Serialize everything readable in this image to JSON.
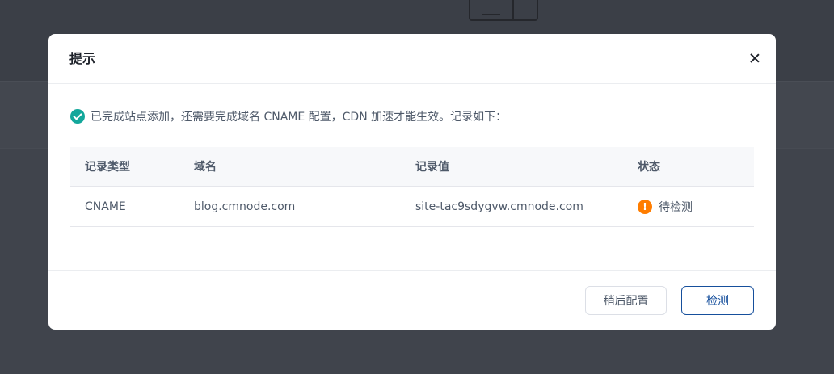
{
  "dialog": {
    "title": "提示",
    "notice": "已完成站点添加，还需要完成域名 CNAME 配置，CDN 加速才能生效。记录如下：",
    "table": {
      "headers": [
        "记录类型",
        "域名",
        "记录值",
        "状态"
      ],
      "rows": [
        {
          "type": "CNAME",
          "domain": "blog.cmnode.com",
          "value": "site-tac9sdygvw.cmnode.com",
          "status": "待检测",
          "status_icon": "warning-icon"
        }
      ]
    },
    "buttons": {
      "later": "稍后配置",
      "check": "检测"
    }
  },
  "colors": {
    "success": "#13a79b",
    "warning": "#ff7d00",
    "primary": "#164f9c",
    "overlay": "#40444c"
  },
  "icons": {
    "close": "close-icon",
    "success": "check-circle-icon",
    "warning": "warning-icon",
    "warning_glyph": "!"
  }
}
